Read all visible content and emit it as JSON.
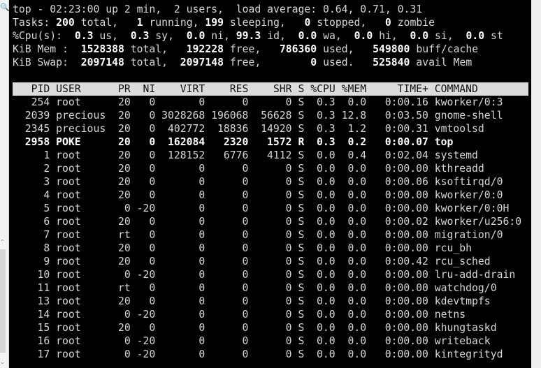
{
  "summary": {
    "line1": "top - 02:23:00 up 2 min,  2 users,  load average: 0.64, 0.71, 0.31",
    "tasks": {
      "label": "Tasks: ",
      "total": "200",
      "t1": " total,   ",
      "running": "1",
      "t2": " running, ",
      "sleeping": "199",
      "t3": " sleeping,   ",
      "stopped": "0",
      "t4": " stopped,   ",
      "zombie": "0",
      "t5": " zombie"
    },
    "cpu": {
      "label": "%Cpu(s):  ",
      "us": "0.3",
      "t1": " us,  ",
      "sy": "0.3",
      "t2": " sy,  ",
      "ni": "0.0",
      "t3": " ni, ",
      "id": "99.3",
      "t4": " id,  ",
      "wa": "0.0",
      "t5": " wa,  ",
      "hi": "0.0",
      "t6": " hi,  ",
      "si": "0.0",
      "t7": " si,  ",
      "st": "0.0",
      "t8": " st"
    },
    "mem": {
      "label": "KiB Mem :  ",
      "total": "1528388",
      "t1": " total,   ",
      "free": "192228",
      "t2": " free,   ",
      "used": "786360",
      "t3": " used,   ",
      "buff": "549800",
      "t4": " buff/cache"
    },
    "swap": {
      "label": "KiB Swap:  ",
      "total": "2097148",
      "t1": " total,  ",
      "free": "2097148",
      "t2": " free,        ",
      "used": "0",
      "t3": " used.   ",
      "avail": "525840",
      "t4": " avail Mem"
    }
  },
  "columns": [
    "PID",
    "USER",
    "PR",
    "NI",
    "VIRT",
    "RES",
    "SHR",
    "S",
    "%CPU",
    "%MEM",
    "TIME+",
    "COMMAND"
  ],
  "rows": [
    [
      "254",
      "root",
      "20",
      "0",
      "0",
      "0",
      "0",
      "S",
      "0.3",
      "0.0",
      "0:00.16",
      "kworker/0:3"
    ],
    [
      "2039",
      "precious",
      "20",
      "0",
      "3028268",
      "196068",
      "56628",
      "S",
      "0.3",
      "12.8",
      "0:03.50",
      "gnome-shell"
    ],
    [
      "2345",
      "precious",
      "20",
      "0",
      "402772",
      "18836",
      "14920",
      "S",
      "0.3",
      "1.2",
      "0:00.31",
      "vmtoolsd"
    ],
    [
      "2958",
      "POKE",
      "20",
      "0",
      "162084",
      "2320",
      "1572",
      "R",
      "0.3",
      "0.2",
      "0:00.07",
      "top"
    ],
    [
      "1",
      "root",
      "20",
      "0",
      "128152",
      "6776",
      "4112",
      "S",
      "0.0",
      "0.4",
      "0:02.04",
      "systemd"
    ],
    [
      "2",
      "root",
      "20",
      "0",
      "0",
      "0",
      "0",
      "S",
      "0.0",
      "0.0",
      "0:00.00",
      "kthreadd"
    ],
    [
      "3",
      "root",
      "20",
      "0",
      "0",
      "0",
      "0",
      "S",
      "0.0",
      "0.0",
      "0:00.06",
      "ksoftirqd/0"
    ],
    [
      "4",
      "root",
      "20",
      "0",
      "0",
      "0",
      "0",
      "S",
      "0.0",
      "0.0",
      "0:00.00",
      "kworker/0:0"
    ],
    [
      "5",
      "root",
      "0",
      "-20",
      "0",
      "0",
      "0",
      "S",
      "0.0",
      "0.0",
      "0:00.00",
      "kworker/0:0H"
    ],
    [
      "6",
      "root",
      "20",
      "0",
      "0",
      "0",
      "0",
      "S",
      "0.0",
      "0.0",
      "0:00.02",
      "kworker/u256:0"
    ],
    [
      "7",
      "root",
      "rt",
      "0",
      "0",
      "0",
      "0",
      "S",
      "0.0",
      "0.0",
      "0:00.00",
      "migration/0"
    ],
    [
      "8",
      "root",
      "20",
      "0",
      "0",
      "0",
      "0",
      "S",
      "0.0",
      "0.0",
      "0:00.00",
      "rcu_bh"
    ],
    [
      "9",
      "root",
      "20",
      "0",
      "0",
      "0",
      "0",
      "S",
      "0.0",
      "0.0",
      "0:00.42",
      "rcu_sched"
    ],
    [
      "10",
      "root",
      "0",
      "-20",
      "0",
      "0",
      "0",
      "S",
      "0.0",
      "0.0",
      "0:00.00",
      "lru-add-drain"
    ],
    [
      "11",
      "root",
      "rt",
      "0",
      "0",
      "0",
      "0",
      "S",
      "0.0",
      "0.0",
      "0:00.00",
      "watchdog/0"
    ],
    [
      "13",
      "root",
      "20",
      "0",
      "0",
      "0",
      "0",
      "S",
      "0.0",
      "0.0",
      "0:00.00",
      "kdevtmpfs"
    ],
    [
      "14",
      "root",
      "0",
      "-20",
      "0",
      "0",
      "0",
      "S",
      "0.0",
      "0.0",
      "0:00.00",
      "netns"
    ],
    [
      "15",
      "root",
      "20",
      "0",
      "0",
      "0",
      "0",
      "S",
      "0.0",
      "0.0",
      "0:00.00",
      "khungtaskd"
    ],
    [
      "16",
      "root",
      "0",
      "-20",
      "0",
      "0",
      "0",
      "S",
      "0.0",
      "0.0",
      "0:00.00",
      "writeback"
    ],
    [
      "17",
      "root",
      "0",
      "-20",
      "0",
      "0",
      "0",
      "S",
      "0.0",
      "0.0",
      "0:00.00",
      "kintegrityd"
    ]
  ],
  "bold_row_index": 3,
  "icons": {
    "search": "search-icon"
  },
  "colors": {
    "background": "#000000",
    "text": "#d6d6d6",
    "header_bar": "#dcdcdc"
  }
}
